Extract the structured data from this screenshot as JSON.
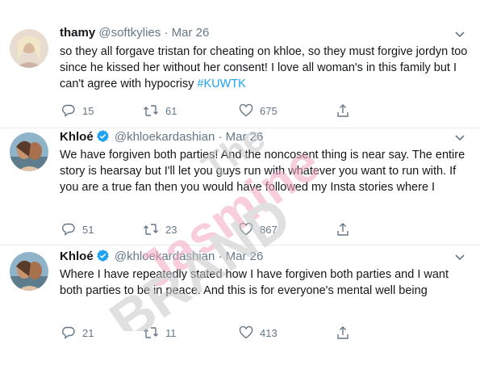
{
  "tweets": [
    {
      "name": "thamy",
      "handle": "@softkylies",
      "dot": "·",
      "date": "Mar 26",
      "verified": false,
      "text_before": "so they all forgave tristan for cheating on khloe, so they must forgive jordyn too since he kissed her without her consent! I love all woman's in this family but I can't agree with hypocrisy ",
      "hashtag": "#KUWTK",
      "replies": "15",
      "retweets": "61",
      "likes": "675"
    },
    {
      "name": "Khloé",
      "handle": "@khloekardashian",
      "dot": "·",
      "date": "Mar 26",
      "verified": true,
      "text_before": "We have forgiven both parties! And the noncosent thing is near say. The entire story is hearsay but I'll let you guys run with whatever you want to run with. If you are a true fan then you would have followed my Insta stories where I",
      "hashtag": "",
      "replies": "51",
      "retweets": "23",
      "likes": "867"
    },
    {
      "name": "Khloé",
      "handle": "@khloekardashian",
      "dot": "·",
      "date": "Mar 26",
      "verified": true,
      "text_before": "Where I have repeatedly stated how I have forgiven both parties and I want both parties to be in peace. And this is for everyone's mental well being",
      "hashtag": "",
      "replies": "21",
      "retweets": "11",
      "likes": "413"
    }
  ],
  "watermark": {
    "line1": "The",
    "line2": "Jasmine",
    "line3": "BRAND"
  },
  "colors": {
    "accent": "#1da1f2",
    "muted": "#657786",
    "text": "#14171a",
    "watermark_pink": "#f4a7c0",
    "watermark_gray": "#c8c8c8"
  },
  "icons": [
    "reply-icon",
    "retweet-icon",
    "like-icon",
    "share-icon",
    "verified-badge-icon",
    "chevron-down-icon"
  ]
}
